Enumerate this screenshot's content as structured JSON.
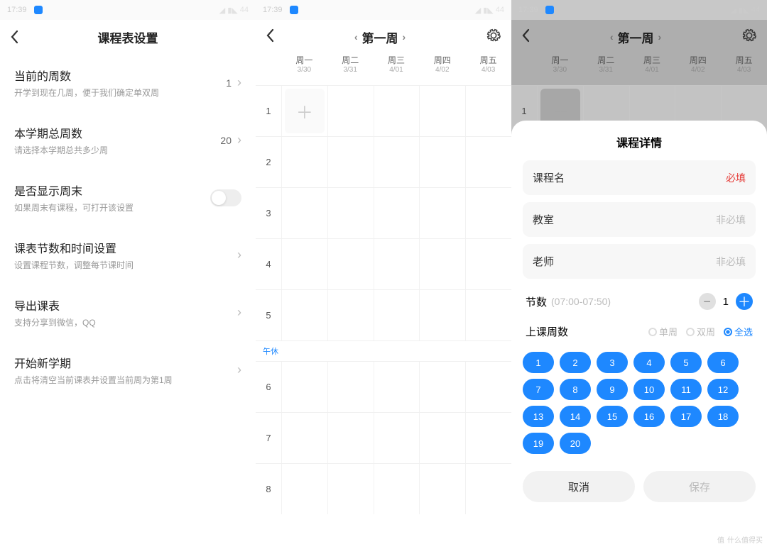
{
  "status": {
    "time": "17:39",
    "battery": "44"
  },
  "screen1": {
    "title": "课程表设置",
    "items": [
      {
        "title": "当前的周数",
        "sub": "开学到现在几周，便于我们确定单双周",
        "value": "1"
      },
      {
        "title": "本学期总周数",
        "sub": "请选择本学期总共多少周",
        "value": "20"
      },
      {
        "title": "是否显示周末",
        "sub": "如果周末有课程，可打开该设置",
        "toggle": true
      },
      {
        "title": "课表节数和时间设置",
        "sub": "设置课程节数，调整每节课时间"
      },
      {
        "title": "导出课表",
        "sub": "支持分享到微信，QQ"
      },
      {
        "title": "开始新学期",
        "sub": "点击将清空当前课表并设置当前周为第1周"
      }
    ]
  },
  "screen2": {
    "week_title": "第一周",
    "days": [
      {
        "name": "周一",
        "date": "3/30"
      },
      {
        "name": "周二",
        "date": "3/31"
      },
      {
        "name": "周三",
        "date": "4/01"
      },
      {
        "name": "周四",
        "date": "4/02"
      },
      {
        "name": "周五",
        "date": "4/03"
      }
    ],
    "periods_before_lunch": [
      "1",
      "2",
      "3",
      "4",
      "5"
    ],
    "lunch_label": "午休",
    "periods_after_lunch": [
      "6",
      "7",
      "8"
    ]
  },
  "screen3": {
    "sheet_title": "课程详情",
    "fields": {
      "course_label": "课程名",
      "course_req": "必填",
      "room_label": "教室",
      "room_opt": "非必填",
      "teacher_label": "老师",
      "teacher_opt": "非必填",
      "period_label": "节数",
      "period_time": "(07:00-07:50)",
      "period_value": "1",
      "weeks_label": "上课周数"
    },
    "radios": [
      {
        "label": "单周",
        "on": false
      },
      {
        "label": "双周",
        "on": false
      },
      {
        "label": "全选",
        "on": true
      }
    ],
    "weeks": [
      "1",
      "2",
      "3",
      "4",
      "5",
      "6",
      "7",
      "8",
      "9",
      "10",
      "11",
      "12",
      "13",
      "14",
      "15",
      "16",
      "17",
      "18",
      "19",
      "20"
    ],
    "cancel": "取消",
    "save": "保存"
  },
  "watermark": "什么值得买"
}
